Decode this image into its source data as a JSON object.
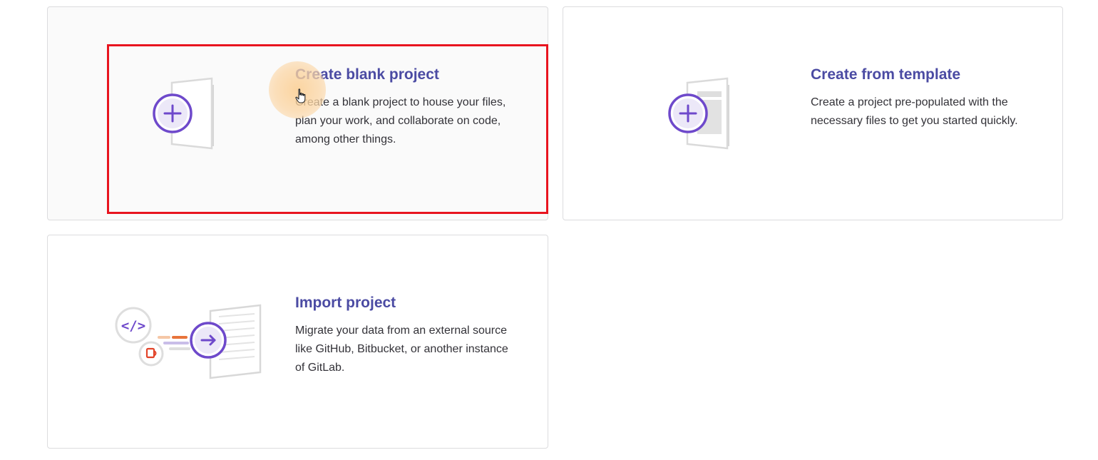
{
  "cards": {
    "blank": {
      "title": "Create blank project",
      "description": "Create a blank project to house your files, plan your work, and collaborate on code, among other things.",
      "icon": "blank-project-illustration"
    },
    "template": {
      "title": "Create from template",
      "description": "Create a project pre-populated with the necessary files to get you started quickly.",
      "icon": "template-project-illustration"
    },
    "import": {
      "title": "Import project",
      "description": "Migrate your data from an external source like GitHub, Bitbucket, or another instance of GitLab.",
      "icon": "import-project-illustration"
    }
  },
  "colors": {
    "title": "#4b4ba3",
    "accent_purple": "#6e49cb",
    "highlight": "#e8141f",
    "orange": "#e24329"
  },
  "annotations": {
    "highlight_target": "blank-project-card",
    "cursor": "hand-pointer"
  }
}
